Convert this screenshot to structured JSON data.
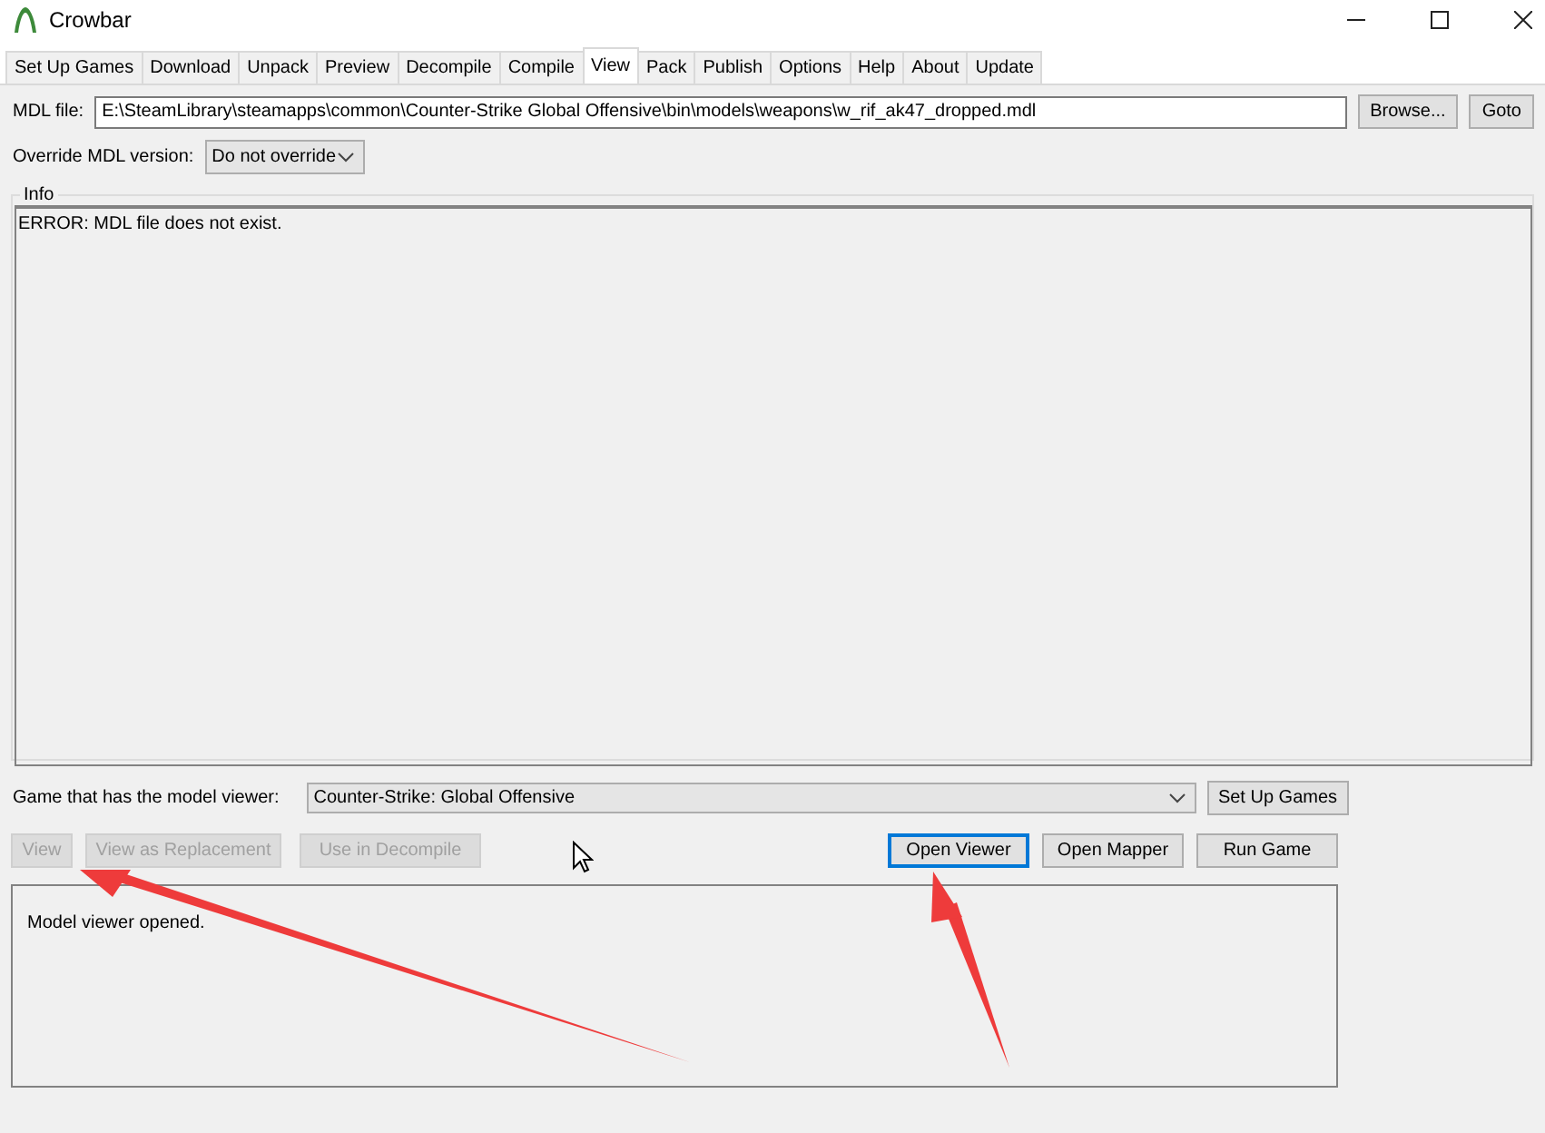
{
  "window": {
    "title": "Crowbar"
  },
  "tabs": [
    {
      "label": "Set Up Games",
      "selected": false
    },
    {
      "label": "Download",
      "selected": false
    },
    {
      "label": "Unpack",
      "selected": false
    },
    {
      "label": "Preview",
      "selected": false
    },
    {
      "label": "Decompile",
      "selected": false
    },
    {
      "label": "Compile",
      "selected": false
    },
    {
      "label": "View",
      "selected": true
    },
    {
      "label": "Pack",
      "selected": false
    },
    {
      "label": "Publish",
      "selected": false
    },
    {
      "label": "Options",
      "selected": false
    },
    {
      "label": "Help",
      "selected": false
    },
    {
      "label": "About",
      "selected": false
    },
    {
      "label": "Update",
      "selected": false
    }
  ],
  "mdl_file": {
    "label": "MDL file:",
    "value": "E:\\SteamLibrary\\steamapps\\common\\Counter-Strike Global Offensive\\bin\\models\\weapons\\w_rif_ak47_dropped.mdl",
    "buttons": [
      "Browse...",
      "Goto"
    ]
  },
  "override": {
    "label": "Override MDL version:",
    "value": "Do not override"
  },
  "info": {
    "title": "Info",
    "text": "ERROR: MDL file does not exist."
  },
  "game": {
    "label": "Game that has the model viewer:",
    "value": "Counter-Strike: Global Offensive",
    "button": "Set Up Games"
  },
  "left_buttons": [
    {
      "label": "View",
      "disabled": true
    },
    {
      "label": "View as Replacement",
      "disabled": true
    },
    {
      "label": "Use in Decompile",
      "disabled": true
    }
  ],
  "right_buttons": [
    {
      "label": "Open Viewer",
      "focused": true
    },
    {
      "label": "Open Mapper",
      "focused": false
    },
    {
      "label": "Run Game",
      "focused": false
    }
  ],
  "log": {
    "text": "Model viewer opened."
  }
}
